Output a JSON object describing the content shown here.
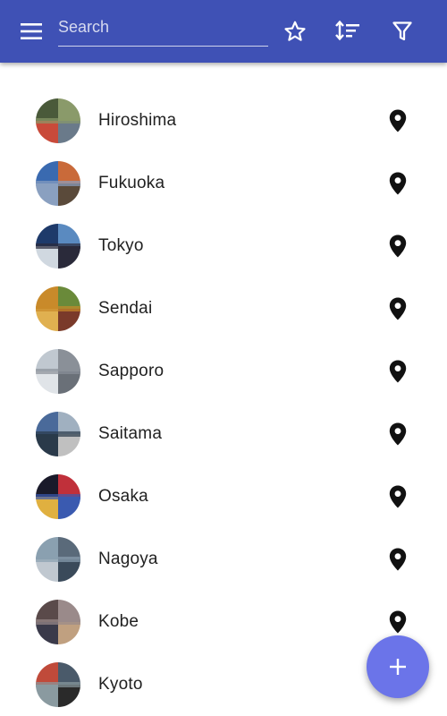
{
  "appbar": {
    "background": "#3f51b5",
    "menu_icon": "menu-icon",
    "search": {
      "placeholder": "Search",
      "value": ""
    },
    "actions": [
      {
        "icon": "star-outline-icon"
      },
      {
        "icon": "sort-icon"
      },
      {
        "icon": "filter-icon"
      }
    ]
  },
  "cities": [
    {
      "name": "Hiroshima",
      "palette": [
        "#4a5a3a",
        "#8a9a6a",
        "#c94a3a",
        "#6a7a8a"
      ]
    },
    {
      "name": "Fukuoka",
      "palette": [
        "#3a6ab0",
        "#c96a3a",
        "#8aa0c0",
        "#5a4a3a"
      ]
    },
    {
      "name": "Tokyo",
      "palette": [
        "#1e3a6a",
        "#5a8ac0",
        "#d0d8e0",
        "#2a2a3a"
      ]
    },
    {
      "name": "Sendai",
      "palette": [
        "#c98a2a",
        "#6a8a3a",
        "#e0b050",
        "#7a3a2a"
      ]
    },
    {
      "name": "Sapporo",
      "palette": [
        "#c0c8d0",
        "#8a9098",
        "#e0e4e8",
        "#6a7078"
      ]
    },
    {
      "name": "Saitama",
      "palette": [
        "#4a6a9a",
        "#a0b0c0",
        "#2a3a4a",
        "#c0c0c0"
      ]
    },
    {
      "name": "Osaka",
      "palette": [
        "#1a1a2a",
        "#c0303a",
        "#e0b040",
        "#3a5ab0"
      ]
    },
    {
      "name": "Nagoya",
      "palette": [
        "#8aa0b0",
        "#5a6a7a",
        "#c0c8d0",
        "#3a4a5a"
      ]
    },
    {
      "name": "Kobe",
      "palette": [
        "#5a4a4a",
        "#9a8a8a",
        "#3a3a4a",
        "#c0a080"
      ]
    },
    {
      "name": "Kyoto",
      "palette": [
        "#c04a3a",
        "#4a5a6a",
        "#8a9aa0",
        "#2a2a2a"
      ]
    }
  ],
  "row_pin_icon": "map-marker-icon",
  "fab": {
    "icon": "plus-icon",
    "background": "#6b74e9"
  }
}
